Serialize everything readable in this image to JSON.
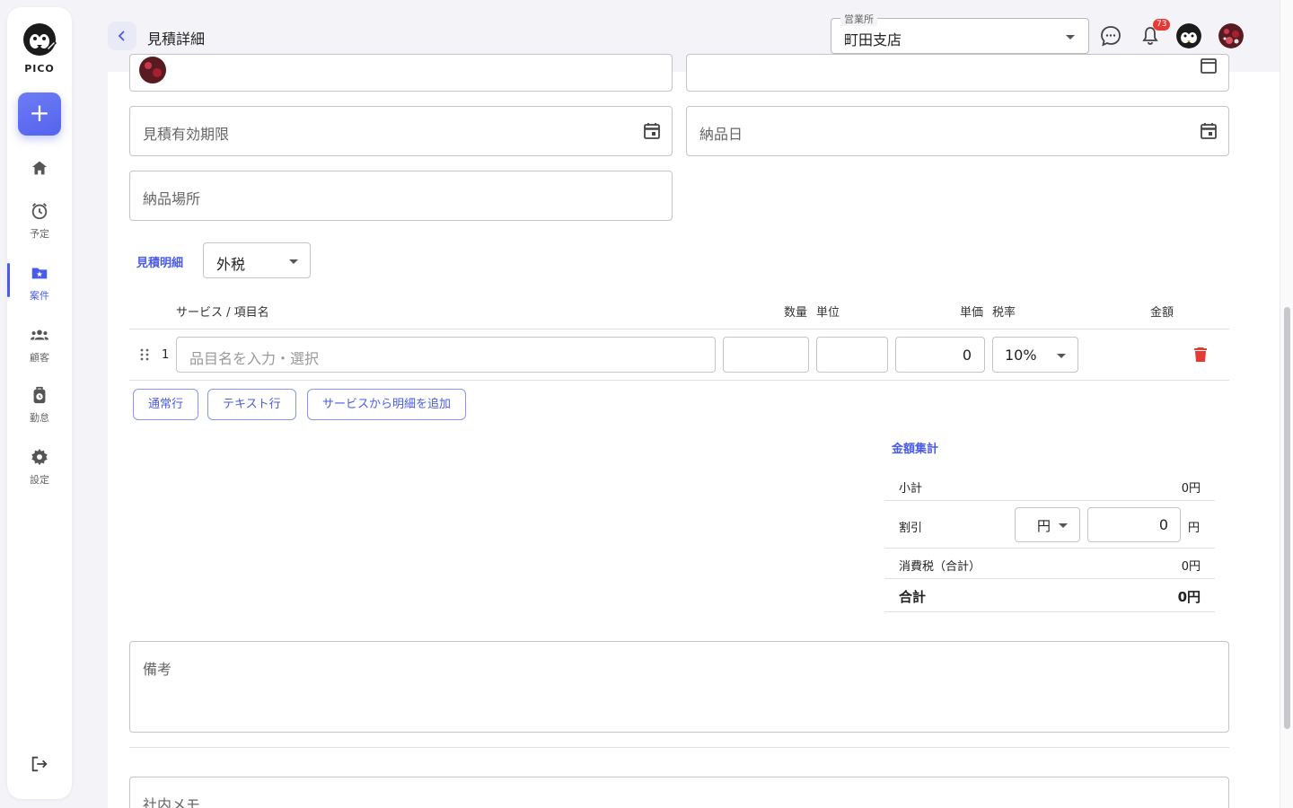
{
  "sidebar": {
    "logo_text": "PICO",
    "items": [
      {
        "name": "home",
        "label": ""
      },
      {
        "name": "schedule",
        "label": "予定"
      },
      {
        "name": "cases",
        "label": "案件"
      },
      {
        "name": "customers",
        "label": "顧客"
      },
      {
        "name": "attendance",
        "label": "勤怠"
      },
      {
        "name": "settings",
        "label": "設定"
      }
    ]
  },
  "header": {
    "title": "見積詳細",
    "office_label": "営業所",
    "office_value": "町田支店",
    "notification_count": "73"
  },
  "form": {
    "valid_until_placeholder": "見積有効期限",
    "delivery_date_placeholder": "納品日",
    "delivery_place_placeholder": "納品場所",
    "remarks_placeholder": "備考",
    "internal_memo_placeholder": "社内メモ"
  },
  "details": {
    "section_label": "見積明細",
    "tax_mode": "外税",
    "columns": {
      "name": "サービス / 項目名",
      "qty": "数量",
      "unit": "単位",
      "price": "単価",
      "tax_rate": "税率",
      "amount": "金額"
    },
    "rows": [
      {
        "index": "1",
        "name_placeholder": "品目名を入力・選択",
        "qty": "",
        "unit": "",
        "price": "0",
        "tax_rate": "10%"
      }
    ],
    "buttons": {
      "normal_row": "通常行",
      "text_row": "テキスト行",
      "add_from_service": "サービスから明細を追加"
    }
  },
  "summary": {
    "section_label": "金額集計",
    "subtotal_label": "小計",
    "subtotal_value": "0円",
    "discount_label": "割引",
    "discount_unit_select": "円",
    "discount_value": "0",
    "discount_suffix": "円",
    "tax_label": "消費税（合計）",
    "tax_value": "0円",
    "total_label": "合計",
    "total_value": "0円"
  },
  "colors": {
    "accent": "#4a5be8",
    "danger": "#e53935"
  }
}
